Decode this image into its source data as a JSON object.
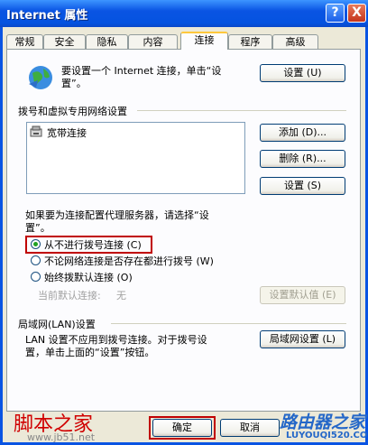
{
  "window": {
    "title": "Internet 属性",
    "help_glyph": "?",
    "close_glyph": "X"
  },
  "tabs": [
    {
      "label": "常规"
    },
    {
      "label": "安全"
    },
    {
      "label": "隐私"
    },
    {
      "label": "内容"
    },
    {
      "label": "连接",
      "active": true
    },
    {
      "label": "程序"
    },
    {
      "label": "高级"
    }
  ],
  "setup": {
    "text_line1": "要设置一个 Internet 连接，单击“设",
    "text_line2": "置”。",
    "button": "设置 (U)"
  },
  "dialup": {
    "section_title": "拨号和虚拟专用网络设置",
    "connections": [
      {
        "name": "宽带连接",
        "icon": "broadband-connection-icon"
      }
    ],
    "add_button": "添加 (D)...",
    "remove_button": "删除 (R)...",
    "settings_button": "设置 (S)"
  },
  "proxy": {
    "hint_line1": "如果要为连接配置代理服务器，请选择“设",
    "hint_line2": "置”。",
    "options": [
      {
        "label": "从不进行拨号连接 (C)",
        "checked": true
      },
      {
        "label": "不论网络连接是否存在都进行拨号 (W)",
        "checked": false
      },
      {
        "label": "始终拨默认连接 (O)",
        "checked": false
      }
    ],
    "current_default_label": "当前默认连接:",
    "current_default_value": "无",
    "set_default_button": "设置默认值 (E)"
  },
  "lan": {
    "section_title": "局域网(LAN)设置",
    "text_line1": "LAN 设置不应用到拨号连接。对于拨号设",
    "text_line2": "置，单击上面的“设置”按钮。",
    "button": "局域网设置 (L)"
  },
  "footer": {
    "ok_button": "确定",
    "cancel_button": "取消"
  },
  "watermarks": {
    "left_text": "脚本之家",
    "left_url": "www.jb51.net",
    "right_text": "路由器之家",
    "right_url": "LUYOUQI520.COM"
  },
  "colors": {
    "highlight_box": "#c00000",
    "title_bar": "#0a54e3"
  }
}
